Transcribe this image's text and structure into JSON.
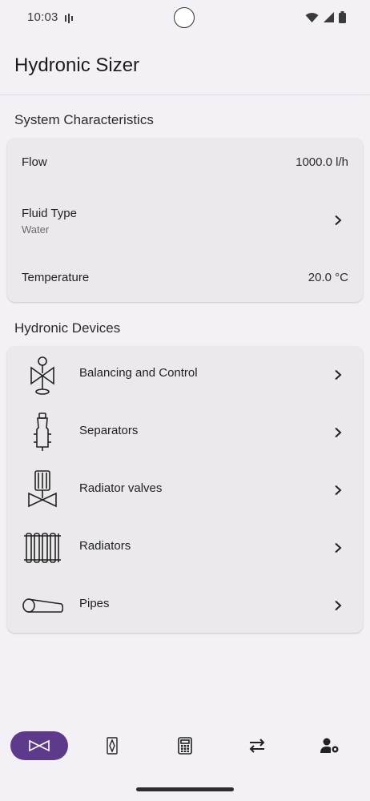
{
  "status": {
    "time": "10:03"
  },
  "app": {
    "title": "Hydronic Sizer"
  },
  "system": {
    "title": "System Characteristics",
    "flow": {
      "label": "Flow",
      "value": "1000.0 l/h"
    },
    "fluid": {
      "label": "Fluid Type",
      "value": "Water"
    },
    "temperature": {
      "label": "Temperature",
      "value": "20.0 °C"
    }
  },
  "devices": {
    "title": "Hydronic Devices",
    "items": [
      {
        "label": "Balancing and Control",
        "icon": "balancing-valve-icon"
      },
      {
        "label": "Separators",
        "icon": "separator-icon"
      },
      {
        "label": "Radiator valves",
        "icon": "radiator-valve-icon"
      },
      {
        "label": "Radiators",
        "icon": "radiator-icon"
      },
      {
        "label": "Pipes",
        "icon": "pipe-icon"
      }
    ]
  },
  "nav": {
    "items": [
      {
        "icon": "valve-nav-icon",
        "active": true
      },
      {
        "icon": "separator-nav-icon",
        "active": false
      },
      {
        "icon": "calculator-icon",
        "active": false
      },
      {
        "icon": "swap-arrows-icon",
        "active": false
      },
      {
        "icon": "user-settings-icon",
        "active": false
      }
    ]
  },
  "colors": {
    "accent": "#5e3a8c",
    "background": "#f4f1f6",
    "card": "#ebe9ec"
  }
}
